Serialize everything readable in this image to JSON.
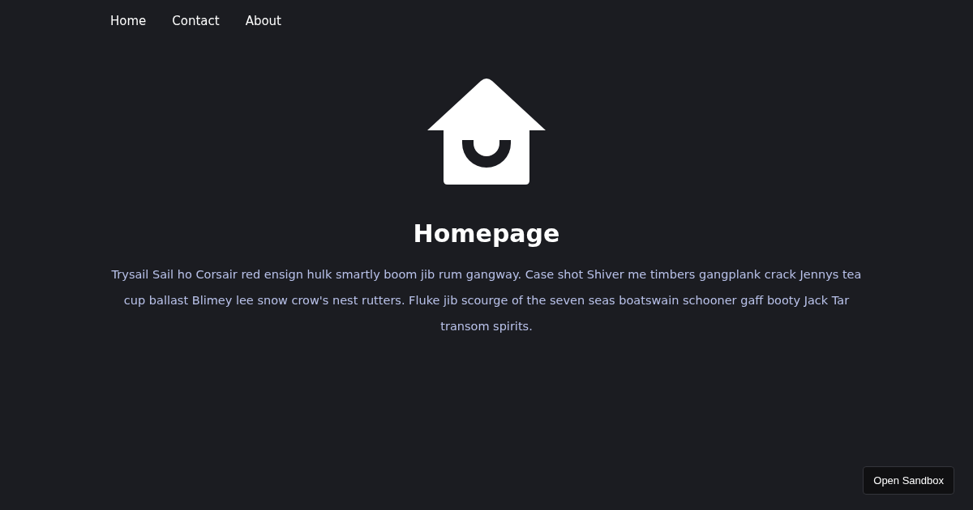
{
  "nav": [
    {
      "label": "Home"
    },
    {
      "label": "Contact"
    },
    {
      "label": "About"
    }
  ],
  "title": "Homepage",
  "body": "Trysail Sail ho Corsair red ensign hulk smartly boom jib rum gangway. Case shot Shiver me timbers gangplank crack Jennys tea cup ballast Blimey lee snow crow's nest rutters. Fluke jib scourge of the seven seas boatswain schooner gaff booty Jack Tar transom spirits.",
  "sandbox_button": "Open Sandbox"
}
